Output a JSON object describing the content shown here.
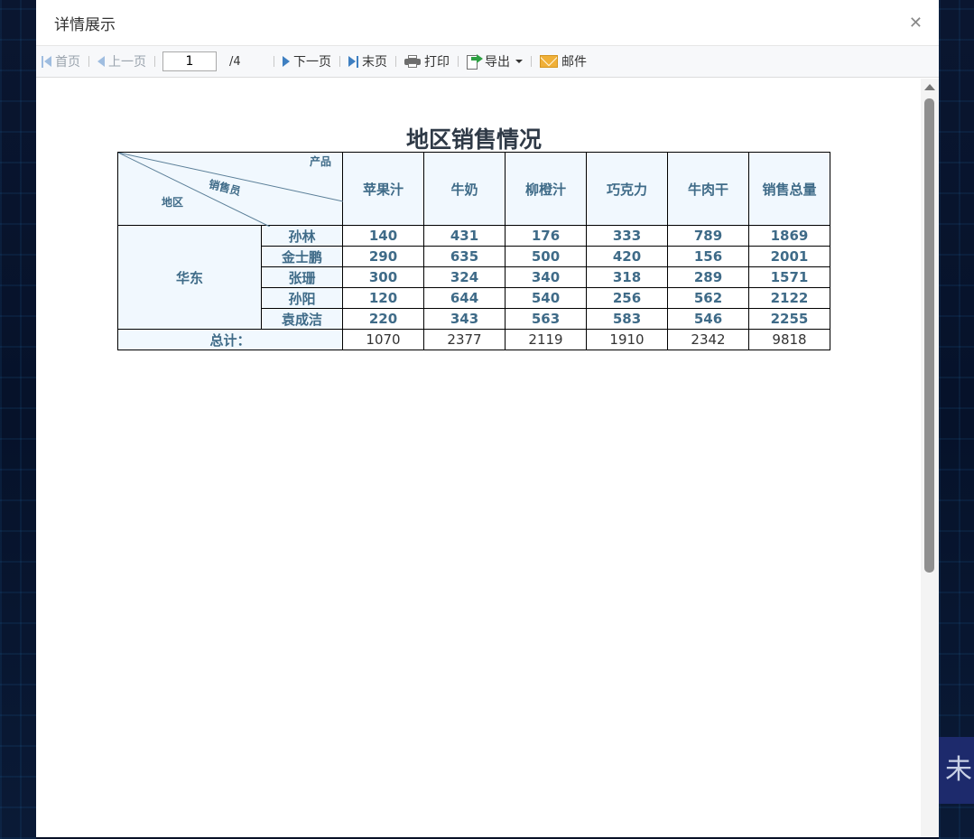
{
  "dialog": {
    "title": "详情展示",
    "close_icon": "close-x-icon"
  },
  "toolbar": {
    "first_label": "首页",
    "prev_label": "上一页",
    "page_current": "1",
    "page_total": "/4",
    "next_label": "下一页",
    "last_label": "末页",
    "print_label": "打印",
    "export_label": "导出",
    "mail_label": "邮件"
  },
  "report": {
    "title": "地区销售情况",
    "corner": {
      "product": "产品",
      "salesperson": "销售员",
      "region": "地区"
    },
    "columns": [
      "苹果汁",
      "牛奶",
      "柳橙汁",
      "巧克力",
      "牛肉干",
      "销售总量"
    ],
    "region": "华东",
    "rows": [
      {
        "name": "孙林",
        "values": [
          "140",
          "431",
          "176",
          "333",
          "789",
          "1869"
        ]
      },
      {
        "name": "金士鹏",
        "values": [
          "290",
          "635",
          "500",
          "420",
          "156",
          "2001"
        ]
      },
      {
        "name": "张珊",
        "values": [
          "300",
          "324",
          "340",
          "318",
          "289",
          "1571"
        ]
      },
      {
        "name": "孙阳",
        "values": [
          "120",
          "644",
          "540",
          "256",
          "562",
          "2122"
        ]
      },
      {
        "name": "袁成洁",
        "values": [
          "220",
          "343",
          "563",
          "583",
          "546",
          "2255"
        ]
      }
    ],
    "total_label": "总计：",
    "totals": [
      "1070",
      "2377",
      "2119",
      "1910",
      "2342",
      "9818"
    ]
  },
  "background": {
    "side_text": "未"
  },
  "colors": {
    "header_text": "#3f6b88",
    "header_bg": "#f1f8fe",
    "toolbar_icon": "#3e7fc1"
  }
}
